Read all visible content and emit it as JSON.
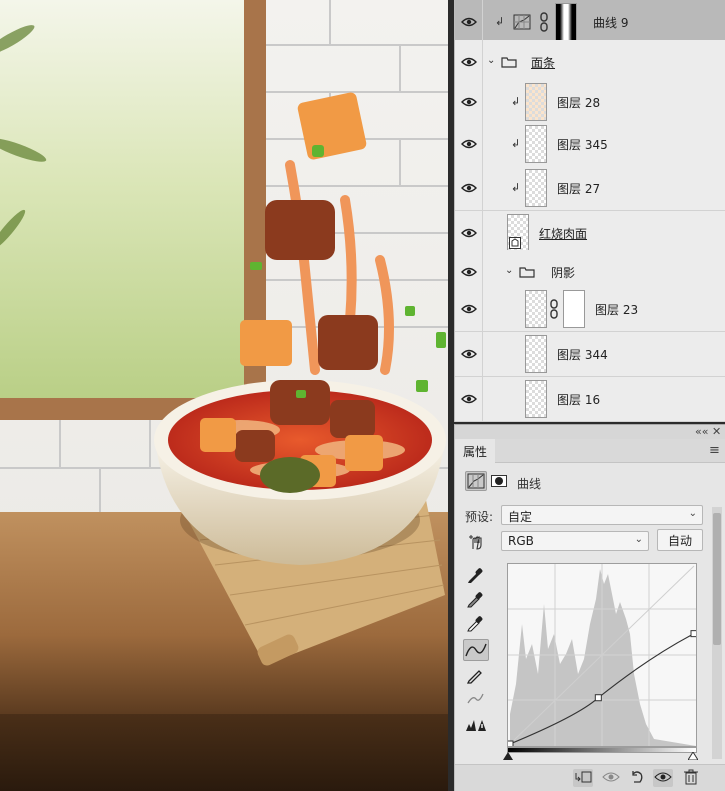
{
  "layers": [
    {
      "name": "曲线 9",
      "kind": "adjustment",
      "selected": true,
      "clipped": true
    },
    {
      "name": "面条",
      "kind": "group",
      "expanded": true,
      "underlined": true
    },
    {
      "name": "图层 28",
      "kind": "pixel",
      "clipped": true
    },
    {
      "name": "图层 345",
      "kind": "pixel",
      "clipped": true
    },
    {
      "name": "图层 27",
      "kind": "pixel",
      "clipped": true
    },
    {
      "name": "红烧肉面",
      "kind": "smart-object",
      "underlined": true
    },
    {
      "name": "阴影",
      "kind": "group",
      "expanded": true
    },
    {
      "name": "图层 23",
      "kind": "pixel-with-mask"
    },
    {
      "name": "图层 344",
      "kind": "pixel"
    },
    {
      "name": "图层 16",
      "kind": "pixel"
    }
  ],
  "properties": {
    "tab_label": "属性",
    "header_collapse": "««",
    "header_close": "✕",
    "menu_icon": "≡",
    "type_label": "曲线",
    "preset_label": "预设:",
    "preset_value": "自定",
    "channel_value": "RGB",
    "auto_button": "自动",
    "curve_points": [
      [
        0,
        0
      ],
      [
        0.48,
        0.26
      ],
      [
        1,
        0.62
      ]
    ]
  },
  "icons": {
    "eye": "eye-icon",
    "folder": "folder-icon",
    "clip": "clip-arrow-icon",
    "link": "chain-link-icon"
  },
  "colors": {
    "panel_bg": "#e8e8e8",
    "selected_row": "#b9b9b9",
    "histogram": "#c5c5c5"
  }
}
